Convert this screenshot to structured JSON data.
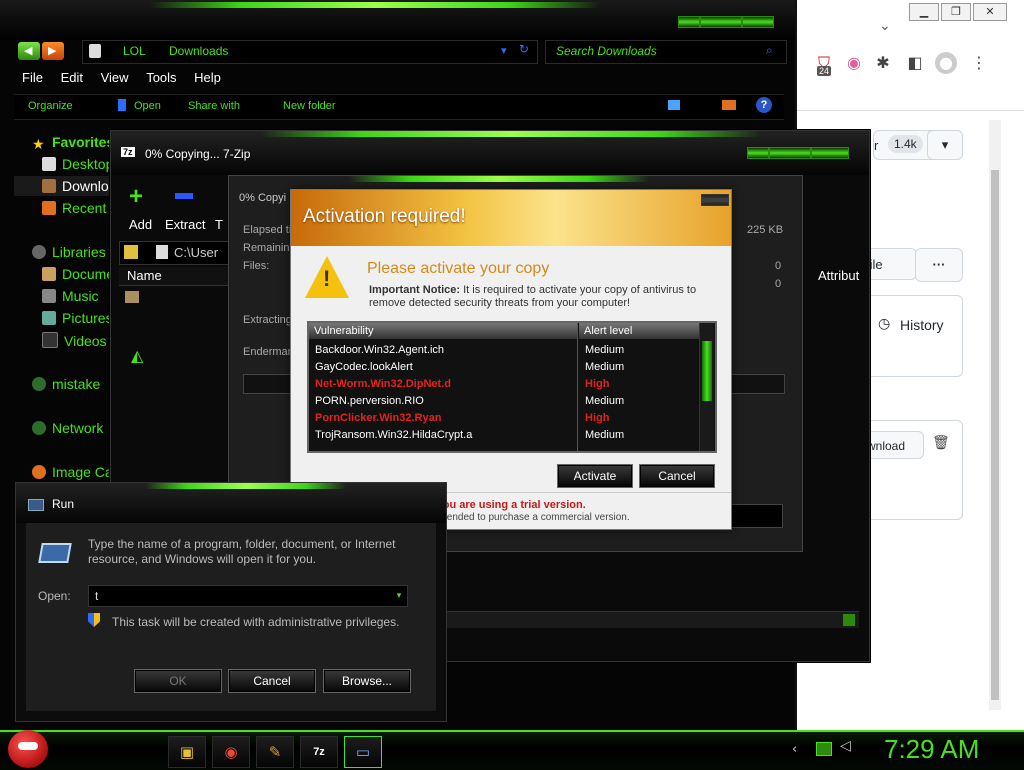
{
  "explorer": {
    "address": {
      "root": "LOL",
      "folder": "Downloads"
    },
    "search_placeholder": "Search Downloads",
    "menu": [
      "File",
      "Edit",
      "View",
      "Tools",
      "Help"
    ],
    "command_bar": [
      "Organize",
      "Open",
      "Share with",
      "New folder"
    ],
    "nav": {
      "favorites": "Favorites",
      "desktop": "Desktop",
      "downloads": "Downloads",
      "recent": "Recent",
      "libraries": "Libraries",
      "documents": "Documents",
      "music": "Music",
      "pictures": "Pictures",
      "videos": "Videos",
      "homegroup": "mistake",
      "network": "Network",
      "image_capture": "Image Ca"
    }
  },
  "zip": {
    "title": "0% Copying... 7-Zip",
    "toolbar": {
      "add": "Add",
      "extract": "Extract",
      "test": "T"
    },
    "path": "C:\\User",
    "column_name": "Name",
    "column_attrib": "Attribut",
    "progress": {
      "title": "0% Copyi",
      "elapsed": "Elapsed ti",
      "remaining": "Remaining",
      "files": "Files:",
      "size": "225 KB",
      "files_val1": "0",
      "files_val2": "0",
      "extracting": "Extracting",
      "item": "Enderman"
    }
  },
  "activation": {
    "title": "Activation required!",
    "heading": "Please activate your copy",
    "notice_bold": "Important Notice:",
    "notice_text": " It is required to activate your copy of antivirus to remove detected security threats from your computer!",
    "table_headers": [
      "Vulnerability",
      "Alert level"
    ],
    "rows": [
      {
        "name": "Backdoor.Win32.Agent.ich",
        "level": "Medium",
        "high": false
      },
      {
        "name": "GayCodec.lookAlert",
        "level": "Medium",
        "high": false
      },
      {
        "name": "Net-Worm.Win32.DipNet.d",
        "level": "High",
        "high": true
      },
      {
        "name": "PORN.perversion.RIO",
        "level": "Medium",
        "high": false
      },
      {
        "name": "PornClicker.Win32.Ryan",
        "level": "High",
        "high": true
      },
      {
        "name": "TrojRansom.Win32.HildaCrypt.a",
        "level": "Medium",
        "high": false
      }
    ],
    "activate_label": "Activate",
    "cancel_label": "Cancel",
    "trial_warning": "You are using a trial version.",
    "trial_recommend": "It is recommended to purchase a commercial version."
  },
  "run": {
    "title": "Run",
    "description": "Type the name of a program, folder, document, or Internet resource, and Windows will open it for you.",
    "open_label": "Open:",
    "open_value": "t",
    "admin_note": "This task will be created with administrative privileges.",
    "ok_label": "OK",
    "cancel_label": "Cancel",
    "browse_label": "Browse..."
  },
  "browser": {
    "badge_count": "24",
    "star_count": "1.4k",
    "star_prefix": "r",
    "file_label": "file",
    "more_label": "···",
    "history_label": "History",
    "download_label": "wnload"
  },
  "taskbar": {
    "clock": "7:29 AM"
  },
  "colors": {
    "accent_green": "#46e21a",
    "warning_red": "#e62020"
  }
}
